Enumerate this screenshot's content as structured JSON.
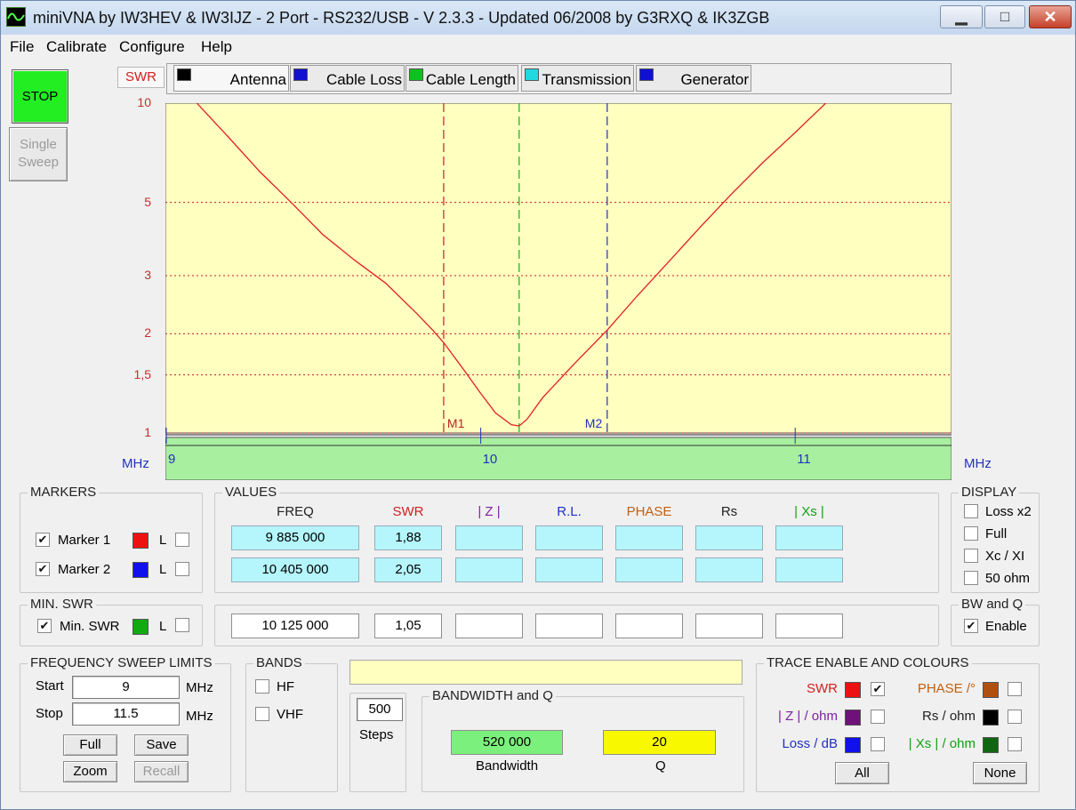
{
  "window": {
    "title": "miniVNA by IW3HEV & IW3IJZ - 2 Port - RS232/USB - V 2.3.3 - Updated 06/2008 by G3RXQ & IK3ZGB"
  },
  "menu": [
    "File",
    "Calibrate",
    "Configure",
    "Help"
  ],
  "left_buttons": {
    "stop": "STOP",
    "single_sweep": "Single Sweep"
  },
  "tabs": {
    "mode_label": "SWR",
    "items": [
      {
        "label": "Antenna",
        "icon": "antenna-icon",
        "color": "#000000"
      },
      {
        "label": "Cable Loss",
        "icon": "cable-loss-icon",
        "color": "#1010d0"
      },
      {
        "label": "Cable Length",
        "icon": "cable-length-icon",
        "color": "#10c020"
      },
      {
        "label": "Transmission",
        "icon": "transmission-icon",
        "color": "#20d8e0"
      },
      {
        "label": "Generator",
        "icon": "generator-icon",
        "color": "#1010d0"
      }
    ]
  },
  "chart_data": {
    "type": "line",
    "title": "",
    "xlabel": "MHz",
    "ylabel": "SWR",
    "x_scale": "linear",
    "xlim": [
      9.0,
      11.5
    ],
    "x_ticks": [
      9,
      10,
      11
    ],
    "y_scale": "log",
    "ylim": [
      1,
      10
    ],
    "y_ticks": [
      1,
      1.5,
      2,
      3,
      5,
      10
    ],
    "grid": "horizontal dotted",
    "background": "#ffffc0",
    "trace_color": "#e02020",
    "series": [
      {
        "name": "SWR",
        "x": [
          9.0,
          9.1,
          9.2,
          9.3,
          9.4,
          9.5,
          9.6,
          9.7,
          9.8,
          9.85,
          9.885,
          9.95,
          10.0,
          10.05,
          10.1,
          10.125,
          10.15,
          10.2,
          10.3,
          10.405,
          10.5,
          10.6,
          10.7,
          10.8,
          10.9,
          11.0,
          11.1,
          11.25
        ],
        "y": [
          13.0,
          10.0,
          7.9,
          6.2,
          5.0,
          4.0,
          3.35,
          2.85,
          2.3,
          2.05,
          1.88,
          1.55,
          1.33,
          1.15,
          1.06,
          1.05,
          1.1,
          1.28,
          1.62,
          2.05,
          2.6,
          3.3,
          4.2,
          5.3,
          6.6,
          8.1,
          10.0,
          13.0
        ]
      }
    ],
    "markers": [
      {
        "label": "M1",
        "x": 9.885,
        "color": "#c02020"
      },
      {
        "label": "Min",
        "x": 10.125,
        "color": "#10b010"
      },
      {
        "label": "M2",
        "x": 10.405,
        "color": "#2030c0"
      }
    ]
  },
  "markers_group": {
    "title": "MARKERS",
    "items": [
      {
        "label": "Marker 1",
        "checked": "✔",
        "color": "#ee1111",
        "l": "L"
      },
      {
        "label": "Marker 2",
        "checked": "✔",
        "color": "#1111ee",
        "l": "L"
      }
    ]
  },
  "values_group": {
    "title": "VALUES",
    "headers": [
      {
        "text": "FREQ",
        "color": "#222222"
      },
      {
        "text": "SWR",
        "color": "#d02020"
      },
      {
        "text": "| Z |",
        "color": "#8020a0"
      },
      {
        "text": "R.L.",
        "color": "#2030c0"
      },
      {
        "text": "PHASE",
        "color": "#c06010"
      },
      {
        "text": "Rs",
        "color": "#222222"
      },
      {
        "text": "| Xs |",
        "color": "#10a010"
      }
    ],
    "rows": [
      [
        "9 885 000",
        "1,88",
        "",
        "",
        "",
        "",
        ""
      ],
      [
        "10 405 000",
        "2,05",
        "",
        "",
        "",
        "",
        ""
      ]
    ],
    "min_row": [
      "10 125 000",
      "1,05",
      "",
      "",
      "",
      "",
      ""
    ]
  },
  "display_group": {
    "title": "DISPLAY",
    "options": [
      "Loss x2",
      "Full",
      "Xc / XI",
      "50 ohm"
    ]
  },
  "min_swr_group": {
    "title": "MIN. SWR",
    "label": "Min. SWR",
    "checked": "✔",
    "color": "#11aa11",
    "l": "L"
  },
  "bwq_group": {
    "title": "BW and Q",
    "label": "Enable",
    "checked": "✔"
  },
  "sweep_group": {
    "title": "FREQUENCY SWEEP LIMITS",
    "start_label": "Start",
    "start_value": "9",
    "stop_label": "Stop",
    "stop_value": "11.5",
    "unit": "MHz",
    "buttons": [
      "Full",
      "Save",
      "Zoom",
      "Recall"
    ]
  },
  "bands_group": {
    "title": "BANDS",
    "options": [
      "HF",
      "VHF"
    ]
  },
  "steps": {
    "value": "500",
    "label": "Steps"
  },
  "bandwidth_group": {
    "title": "BANDWIDTH and Q",
    "bandwidth_value": "520 000",
    "bandwidth_label": "Bandwidth",
    "bandwidth_color": "#7cf07c",
    "q_value": "20",
    "q_label": "Q",
    "q_color": "#f8f800"
  },
  "trace_group": {
    "title": "TRACE ENABLE AND COLOURS",
    "items": [
      {
        "label": "SWR",
        "color": "#ee1111",
        "label_color": "#d02020",
        "checked": "✔"
      },
      {
        "label": "PHASE /°",
        "color": "#b05010",
        "label_color": "#c06010",
        "checked": ""
      },
      {
        "label": "| Z | / ohm",
        "color": "#70107a",
        "label_color": "#8020a0",
        "checked": ""
      },
      {
        "label": "Rs / ohm",
        "color": "#000000",
        "label_color": "#222222",
        "checked": ""
      },
      {
        "label": "Loss / dB",
        "color": "#1111ee",
        "label_color": "#2030c0",
        "checked": ""
      },
      {
        "label": "| Xs | / ohm",
        "color": "#116611",
        "label_color": "#10a010",
        "checked": ""
      }
    ],
    "buttons": [
      "All",
      "None"
    ]
  }
}
